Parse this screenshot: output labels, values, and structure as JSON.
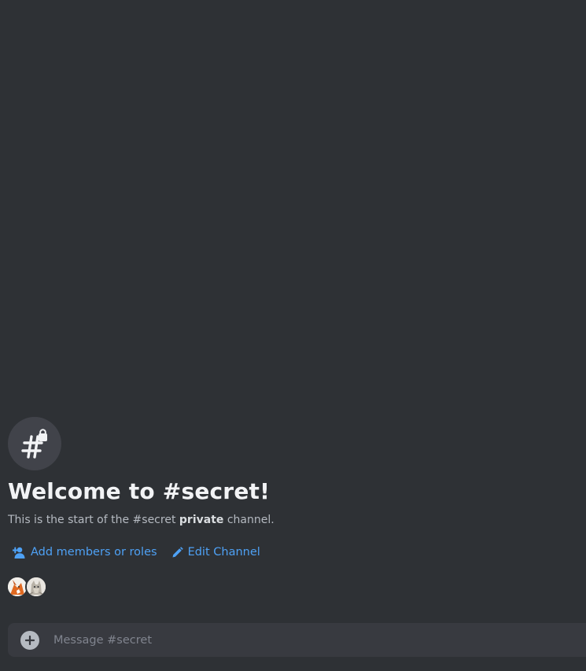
{
  "welcome": {
    "title": "Welcome to #secret!",
    "subtitle_before": "This is the start of the #secret ",
    "subtitle_bold": "private",
    "subtitle_after": " channel."
  },
  "actions": [
    {
      "label": "Add members or roles",
      "icon": "add-members-icon"
    },
    {
      "label": "Edit Channel",
      "icon": "pencil-icon"
    }
  ],
  "members": [
    {
      "icon": "avatar-fox"
    },
    {
      "icon": "avatar-cat"
    }
  ],
  "composer": {
    "placeholder": "Message #secret",
    "add_icon": "plus-icon"
  },
  "colors": {
    "background": "#2e3135",
    "link": "#4ea1f5",
    "composer": "#383a40"
  }
}
